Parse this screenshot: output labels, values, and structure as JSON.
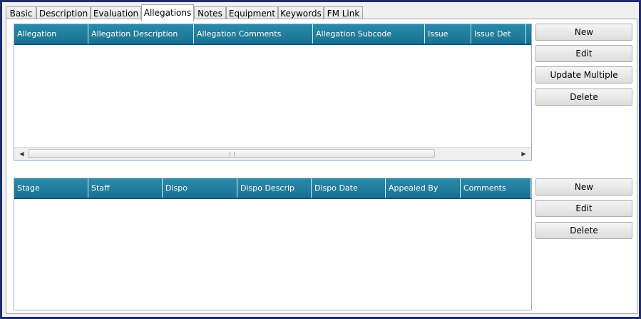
{
  "tabs": [
    "Basic",
    "Description",
    "Evaluation",
    "Allegations",
    "Notes",
    "Equipment",
    "Keywords",
    "FM Link"
  ],
  "active_tab": "Allegations",
  "allegations_grid": {
    "columns": [
      "Allegation",
      "Allegation Description",
      "Allegation Comments",
      "Allegation Subcode",
      "Issue",
      "Issue Det"
    ],
    "rows": []
  },
  "allegations_buttons": {
    "new": "New",
    "edit": "Edit",
    "update_multiple": "Update Multiple",
    "delete": "Delete"
  },
  "dispositions_grid": {
    "columns": [
      "Stage",
      "Staff",
      "Dispo",
      "Dispo Descrip",
      "Dispo Date",
      "Appealed By",
      "Comments"
    ],
    "rows": []
  },
  "dispositions_buttons": {
    "new": "New",
    "edit": "Edit",
    "delete": "Delete"
  },
  "colors": {
    "header": "#1a7192",
    "frame": "#1e2e6e",
    "background": "#f0f0f0"
  }
}
